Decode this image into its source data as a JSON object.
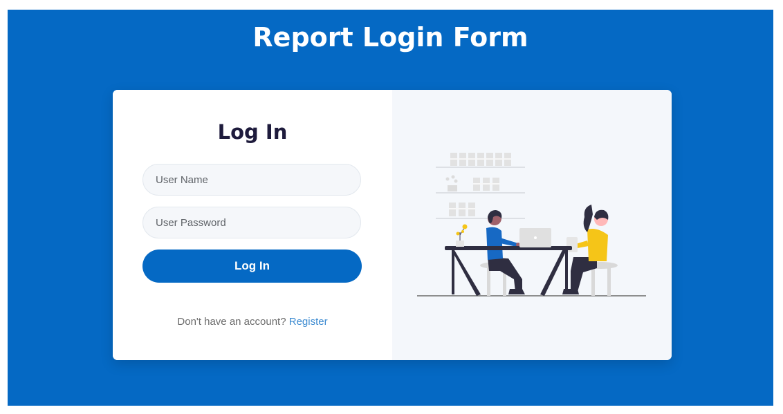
{
  "page": {
    "title": "Report Login Form"
  },
  "form": {
    "heading": "Log In",
    "username_placeholder": "User Name",
    "password_placeholder": "User Password",
    "submit_label": "Log In",
    "register_prompt": "Don't have an account?",
    "register_link": "Register"
  },
  "colors": {
    "brand_blue": "#0569c4",
    "heading_dark": "#1e1b3c",
    "link_blue": "#3d8bd1",
    "illustration_bg": "#f4f7fb",
    "figure_yellow": "#f5c518",
    "figure_blue": "#1769c4"
  },
  "illustration": {
    "icon": "office-workers-illustration"
  }
}
